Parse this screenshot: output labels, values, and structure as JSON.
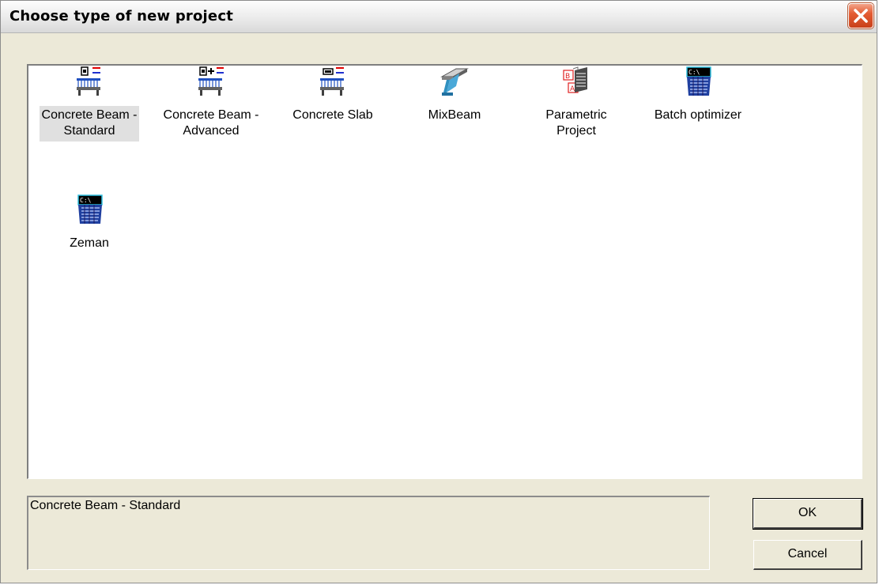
{
  "window": {
    "title": "Choose type of new project"
  },
  "icons": {
    "close": "close-icon"
  },
  "projects": [
    {
      "label": "Concrete Beam -\nStandard",
      "icon": "concrete-beam-standard-icon",
      "selected": true
    },
    {
      "label": "Concrete Beam -\nAdvanced",
      "icon": "concrete-beam-advanced-icon",
      "selected": false
    },
    {
      "label": "Concrete Slab",
      "icon": "concrete-slab-icon",
      "selected": false
    },
    {
      "label": "MixBeam",
      "icon": "mixbeam-icon",
      "selected": false
    },
    {
      "label": "Parametric\nProject",
      "icon": "parametric-project-icon",
      "selected": false
    },
    {
      "label": "Batch optimizer",
      "icon": "batch-optimizer-icon",
      "selected": false
    },
    {
      "label": "Zeman",
      "icon": "zeman-icon",
      "selected": false
    }
  ],
  "description": {
    "text": "Concrete Beam - Standard"
  },
  "buttons": {
    "ok": "OK",
    "cancel": "Cancel"
  },
  "colors": {
    "dialog_bg": "#ece9d8",
    "selection": "#e0e0e0",
    "close_red": "#e45c33"
  }
}
